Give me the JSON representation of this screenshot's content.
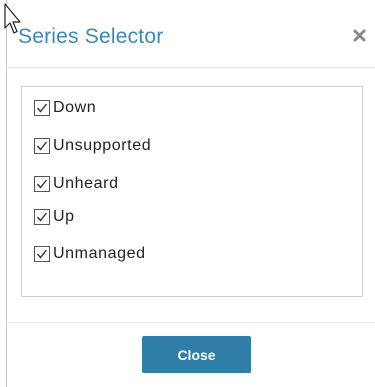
{
  "dialog": {
    "title": "Series Selector",
    "close_icon": "close-x-icon",
    "close_button_label": "Close"
  },
  "series": [
    {
      "label": "Down",
      "checked": true
    },
    {
      "label": "Unsupported",
      "checked": true
    },
    {
      "label": "Unheard",
      "checked": true
    },
    {
      "label": "Up",
      "checked": true
    },
    {
      "label": "Unmanaged",
      "checked": true
    }
  ],
  "colors": {
    "title": "#3b88b8",
    "button": "#2e7ea8"
  }
}
